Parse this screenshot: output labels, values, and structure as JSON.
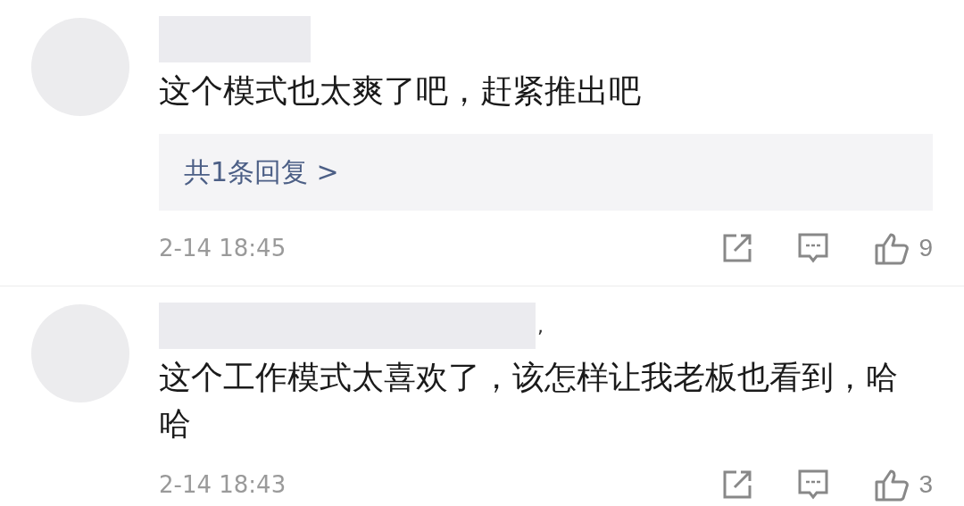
{
  "comments": [
    {
      "text": "这个模式也太爽了吧，赶紧推出吧",
      "reply_link": "共1条回复 >",
      "time": "2-14 18:45",
      "likes": "9"
    },
    {
      "name_suffix": ",",
      "text": "这个工作模式太喜欢了，该怎样让我老板也看到，哈哈",
      "time": "2-14 18:43",
      "likes": "3"
    }
  ]
}
